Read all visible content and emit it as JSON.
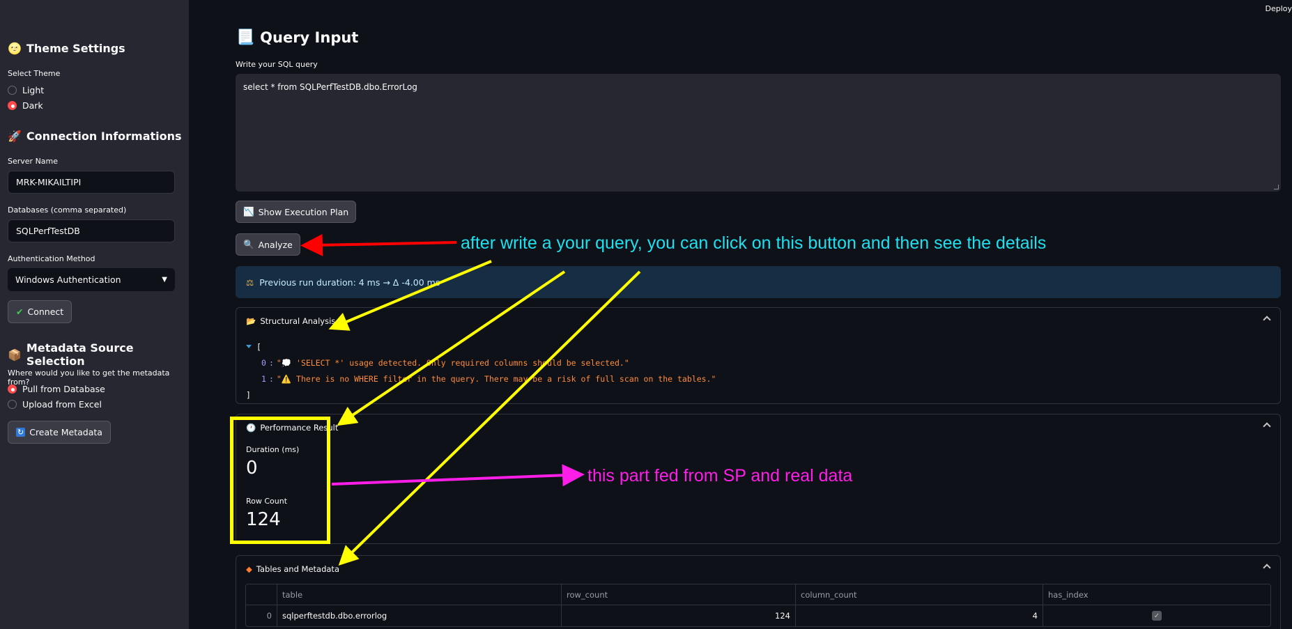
{
  "topbar": {
    "deploy_label": "Deploy"
  },
  "sidebar": {
    "theme": {
      "heading": "Theme Settings",
      "label": "Select Theme",
      "options": [
        "Light",
        "Dark"
      ],
      "selected": "Dark"
    },
    "connection": {
      "heading": "Connection Informations",
      "server_label": "Server Name",
      "server_value": "MRK-MIKAILTIPI",
      "db_label": "Databases (comma separated)",
      "db_value": "SQLPerfTestDB",
      "auth_label": "Authentication Method",
      "auth_value": "Windows Authentication",
      "connect_label": "Connect"
    },
    "metadata": {
      "heading": "Metadata Source Selection",
      "label": "Where would you like to get the metadata from?",
      "options": [
        "Pull from Database",
        "Upload from Excel"
      ],
      "selected": "Pull from Database",
      "create_label": "Create Metadata"
    }
  },
  "main": {
    "heading": "Query Input",
    "query_label": "Write your SQL query",
    "query_value": "select * from SQLPerfTestDB.dbo.ErrorLog",
    "exec_plan_label": "Show Execution Plan",
    "analyze_label": "Analyze",
    "info_text": "Previous run duration: 4 ms → Δ -4.00 ms",
    "structural": {
      "title": "Structural Analysis",
      "open_bracket": "[",
      "close_bracket": "]",
      "items": [
        {
          "index": "0",
          "text": "\"💭 'SELECT *' usage detected. Only required columns should be selected.\""
        },
        {
          "index": "1",
          "text": "\"⚠️ There is no WHERE filter in the query. There may be a risk of full scan on the tables.\""
        }
      ]
    },
    "performance": {
      "title": "Performance Result",
      "duration_label": "Duration (ms)",
      "duration_value": "0",
      "rowcount_label": "Row Count",
      "rowcount_value": "124"
    },
    "tables": {
      "title": "Tables and Metadata",
      "columns": [
        "table",
        "row_count",
        "column_count",
        "has_index"
      ],
      "rows": [
        {
          "idx": "0",
          "table": "sqlperftestdb.dbo.errorlog",
          "row_count": "124",
          "column_count": "4",
          "has_index": true
        }
      ]
    }
  },
  "annotations": {
    "note1": "after write a your query, you can click on this button and then see the details",
    "note2": "this part fed from SP and real data",
    "colors": {
      "cyan": "#1fe0ee",
      "magenta": "#ff1ee8",
      "yellow": "#ffff00",
      "red": "#ff0000"
    }
  }
}
